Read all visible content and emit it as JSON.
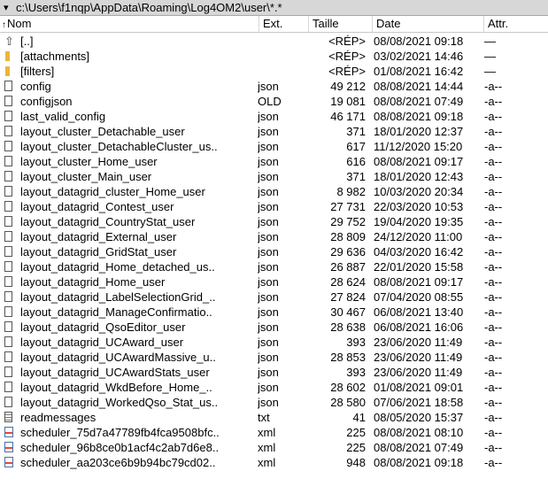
{
  "path_bar": {
    "chevron": "▾",
    "path": "c:\\Users\\f1nqp\\AppData\\Roaming\\Log4OM2\\user\\*.*"
  },
  "columns": {
    "sort_arrow": "↑",
    "name": "Nom",
    "ext": "Ext.",
    "size": "Taille",
    "date": "Date",
    "attr": "Attr."
  },
  "rows": [
    {
      "icon": "up-icon",
      "name": "[..]",
      "ext": "",
      "size": "<RÉP>",
      "date": "08/08/2021 09:18",
      "attr": "—"
    },
    {
      "icon": "folder-icon",
      "name": "[attachments]",
      "ext": "",
      "size": "<RÉP>",
      "date": "03/02/2021 14:46",
      "attr": "—"
    },
    {
      "icon": "folder-icon",
      "name": "[filters]",
      "ext": "",
      "size": "<RÉP>",
      "date": "01/08/2021 16:42",
      "attr": "—"
    },
    {
      "icon": "file-icon",
      "name": "config",
      "ext": "json",
      "size": "49 212",
      "date": "08/08/2021 14:44",
      "attr": "-a--"
    },
    {
      "icon": "file-icon",
      "name": "configjson",
      "ext": "OLD",
      "size": "19 081",
      "date": "08/08/2021 07:49",
      "attr": "-a--"
    },
    {
      "icon": "file-icon",
      "name": "last_valid_config",
      "ext": "json",
      "size": "46 171",
      "date": "08/08/2021 09:18",
      "attr": "-a--"
    },
    {
      "icon": "file-icon",
      "name": "layout_cluster_Detachable_user",
      "ext": "json",
      "size": "371",
      "date": "18/01/2020 12:37",
      "attr": "-a--"
    },
    {
      "icon": "file-icon",
      "name": "layout_cluster_DetachableCluster_us..",
      "ext": "json",
      "size": "617",
      "date": "11/12/2020 15:20",
      "attr": "-a--"
    },
    {
      "icon": "file-icon",
      "name": "layout_cluster_Home_user",
      "ext": "json",
      "size": "616",
      "date": "08/08/2021 09:17",
      "attr": "-a--"
    },
    {
      "icon": "file-icon",
      "name": "layout_cluster_Main_user",
      "ext": "json",
      "size": "371",
      "date": "18/01/2020 12:43",
      "attr": "-a--"
    },
    {
      "icon": "file-icon",
      "name": "layout_datagrid_cluster_Home_user",
      "ext": "json",
      "size": "8 982",
      "date": "10/03/2020 20:34",
      "attr": "-a--"
    },
    {
      "icon": "file-icon",
      "name": "layout_datagrid_Contest_user",
      "ext": "json",
      "size": "27 731",
      "date": "22/03/2020 10:53",
      "attr": "-a--"
    },
    {
      "icon": "file-icon",
      "name": "layout_datagrid_CountryStat_user",
      "ext": "json",
      "size": "29 752",
      "date": "19/04/2020 19:35",
      "attr": "-a--"
    },
    {
      "icon": "file-icon",
      "name": "layout_datagrid_External_user",
      "ext": "json",
      "size": "28 809",
      "date": "24/12/2020 11:00",
      "attr": "-a--"
    },
    {
      "icon": "file-icon",
      "name": "layout_datagrid_GridStat_user",
      "ext": "json",
      "size": "29 636",
      "date": "04/03/2020 16:42",
      "attr": "-a--"
    },
    {
      "icon": "file-icon",
      "name": "layout_datagrid_Home_detached_us..",
      "ext": "json",
      "size": "26 887",
      "date": "22/01/2020 15:58",
      "attr": "-a--"
    },
    {
      "icon": "file-icon",
      "name": "layout_datagrid_Home_user",
      "ext": "json",
      "size": "28 624",
      "date": "08/08/2021 09:17",
      "attr": "-a--"
    },
    {
      "icon": "file-icon",
      "name": "layout_datagrid_LabelSelectionGrid_..",
      "ext": "json",
      "size": "27 824",
      "date": "07/04/2020 08:55",
      "attr": "-a--"
    },
    {
      "icon": "file-icon",
      "name": "layout_datagrid_ManageConfirmatio..",
      "ext": "json",
      "size": "30 467",
      "date": "06/08/2021 13:40",
      "attr": "-a--"
    },
    {
      "icon": "file-icon",
      "name": "layout_datagrid_QsoEditor_user",
      "ext": "json",
      "size": "28 638",
      "date": "06/08/2021 16:06",
      "attr": "-a--"
    },
    {
      "icon": "file-icon",
      "name": "layout_datagrid_UCAward_user",
      "ext": "json",
      "size": "393",
      "date": "23/06/2020 11:49",
      "attr": "-a--"
    },
    {
      "icon": "file-icon",
      "name": "layout_datagrid_UCAwardMassive_u..",
      "ext": "json",
      "size": "28 853",
      "date": "23/06/2020 11:49",
      "attr": "-a--"
    },
    {
      "icon": "file-icon",
      "name": "layout_datagrid_UCAwardStats_user",
      "ext": "json",
      "size": "393",
      "date": "23/06/2020 11:49",
      "attr": "-a--"
    },
    {
      "icon": "file-icon",
      "name": "layout_datagrid_WkdBefore_Home_..",
      "ext": "json",
      "size": "28 602",
      "date": "01/08/2021 09:01",
      "attr": "-a--"
    },
    {
      "icon": "file-icon",
      "name": "layout_datagrid_WorkedQso_Stat_us..",
      "ext": "json",
      "size": "28 580",
      "date": "07/06/2021 18:58",
      "attr": "-a--"
    },
    {
      "icon": "text-file-icon",
      "name": "readmessages",
      "ext": "txt",
      "size": "41",
      "date": "08/05/2020 15:37",
      "attr": "-a--"
    },
    {
      "icon": "xml-file-icon",
      "name": "scheduler_75d7a47789fb4fca9508bfc..",
      "ext": "xml",
      "size": "225",
      "date": "08/08/2021 08:10",
      "attr": "-a--"
    },
    {
      "icon": "xml-file-icon",
      "name": "scheduler_96b8ce0b1acf4c2ab7d6e8..",
      "ext": "xml",
      "size": "225",
      "date": "08/08/2021 07:49",
      "attr": "-a--"
    },
    {
      "icon": "xml-file-icon",
      "name": "scheduler_aa203ce6b9b94bc79cd02..",
      "ext": "xml",
      "size": "948",
      "date": "08/08/2021 09:18",
      "attr": "-a--"
    }
  ]
}
